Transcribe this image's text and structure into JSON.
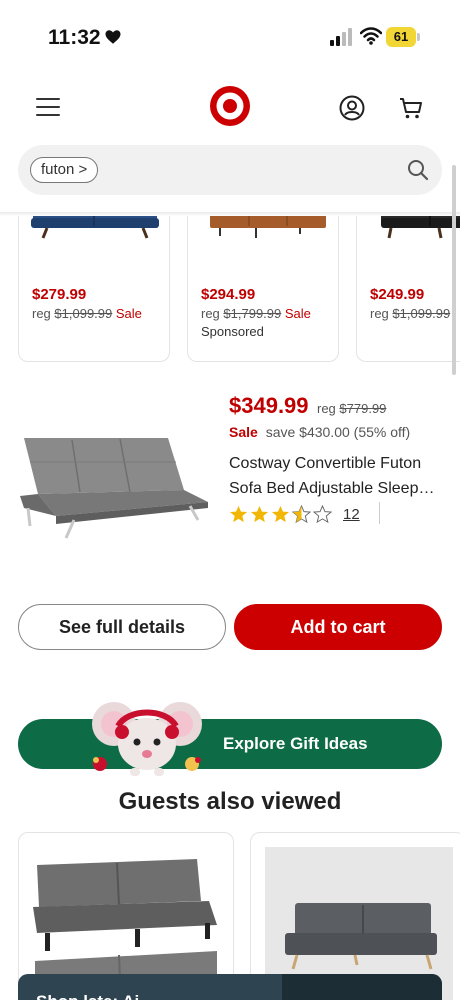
{
  "status_bar": {
    "time": "11:32",
    "battery": "61",
    "icons": [
      "heart-icon",
      "signal-icon",
      "wifi-icon",
      "battery-icon"
    ]
  },
  "header": {
    "icons": [
      "menu-icon",
      "target-logo",
      "account-icon",
      "cart-icon"
    ],
    "brand_color": "#cc0000"
  },
  "search": {
    "chip_label": "futon >",
    "icon": "search-icon"
  },
  "carousel": {
    "items": [
      {
        "price": "$279.99",
        "reg_prefix": "reg",
        "reg_price": "$1,099.99",
        "sale": "Sale",
        "sponsored": ""
      },
      {
        "price": "$294.99",
        "reg_prefix": "reg",
        "reg_price": "$1,799.99",
        "sale": "Sale",
        "sponsored": "Sponsored"
      },
      {
        "price": "$249.99",
        "reg_prefix": "reg",
        "reg_price": "$1,099.99",
        "sale": "",
        "sponsored": ""
      }
    ]
  },
  "featured": {
    "price": "$349.99",
    "reg_prefix": "reg",
    "reg_price": "$779.99",
    "sale": "Sale",
    "save_text": "save $430.00 (55% off)",
    "title_line1": "Costway Convertible Futon",
    "title_line2": "Sofa Bed Adjustable Sleep…",
    "rating": 3.5,
    "review_count": "12"
  },
  "actions": {
    "details_label": "See full details",
    "cart_label": "Add to cart"
  },
  "gift_banner": {
    "label": "Explore Gift Ideas",
    "color": "#0d6b46"
  },
  "also_viewed": {
    "title": "Guests also viewed"
  },
  "bottom_sheet": {
    "label": "Shop late: Ai"
  },
  "colors": {
    "price_red": "#c00000",
    "accent_red": "#cc0000",
    "gift_green": "#0d6b46"
  }
}
